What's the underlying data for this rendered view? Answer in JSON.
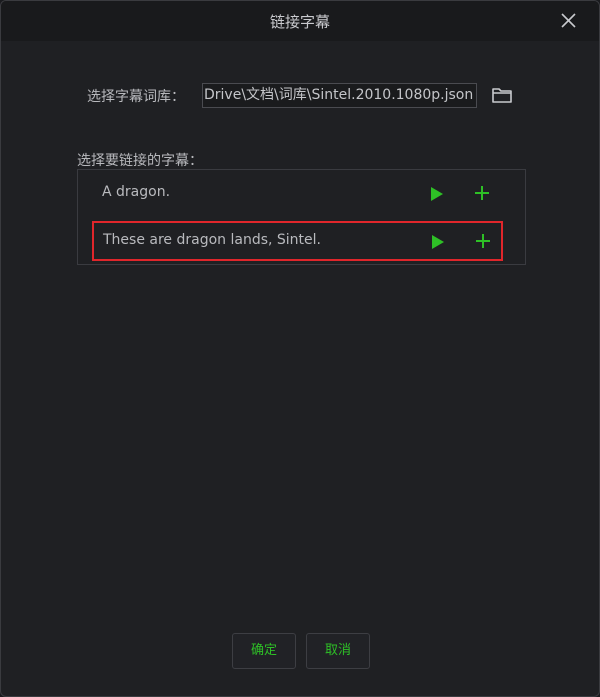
{
  "window": {
    "title": "链接字幕"
  },
  "dictionary": {
    "label": "选择字幕词库：",
    "path": "Drive\\文档\\词库\\Sintel.2010.1080p.json"
  },
  "subtitles": {
    "label": "选择要链接的字幕：",
    "items": [
      {
        "text": "A dragon.",
        "selected": false
      },
      {
        "text": "These are dragon lands, Sintel.",
        "selected": true
      }
    ]
  },
  "buttons": {
    "ok": "确定",
    "cancel": "取消"
  },
  "icons": {
    "close": "close-icon",
    "folder": "folder-icon",
    "play": "play-icon",
    "add": "plus-icon"
  },
  "colors": {
    "accent_green": "#2ec026",
    "selection_border": "#e0262b",
    "background": "#1f2023"
  }
}
